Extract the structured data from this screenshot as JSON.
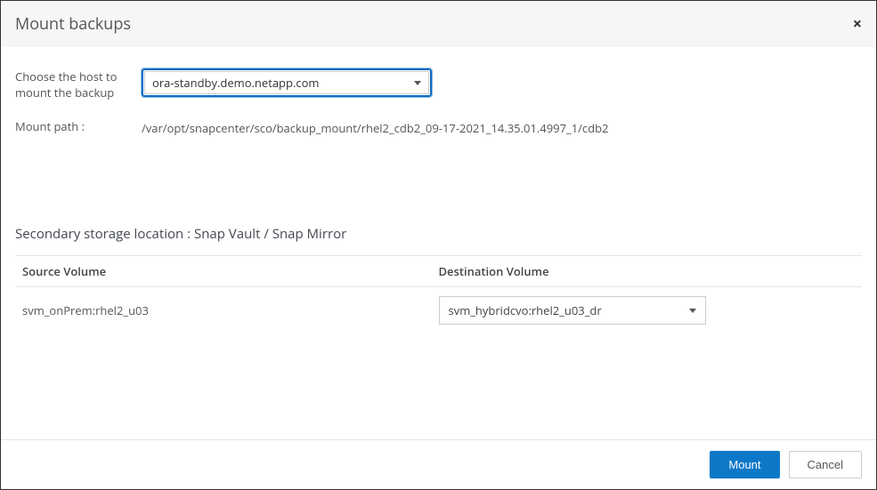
{
  "header": {
    "title": "Mount backups",
    "close": "×"
  },
  "host": {
    "label": "Choose the host to mount the backup",
    "selected": "ora-standby.demo.netapp.com"
  },
  "mount_path": {
    "label": "Mount path :",
    "value": "/var/opt/snapcenter/sco/backup_mount/rhel2_cdb2_09-17-2021_14.35.01.4997_1/cdb2"
  },
  "secondary": {
    "title": "Secondary storage location : Snap Vault / Snap Mirror",
    "columns": {
      "source": "Source Volume",
      "destination": "Destination Volume"
    },
    "rows": [
      {
        "source": "svm_onPrem:rhel2_u03",
        "destination": "svm_hybridcvo:rhel2_u03_dr"
      }
    ]
  },
  "footer": {
    "mount": "Mount",
    "cancel": "Cancel"
  }
}
